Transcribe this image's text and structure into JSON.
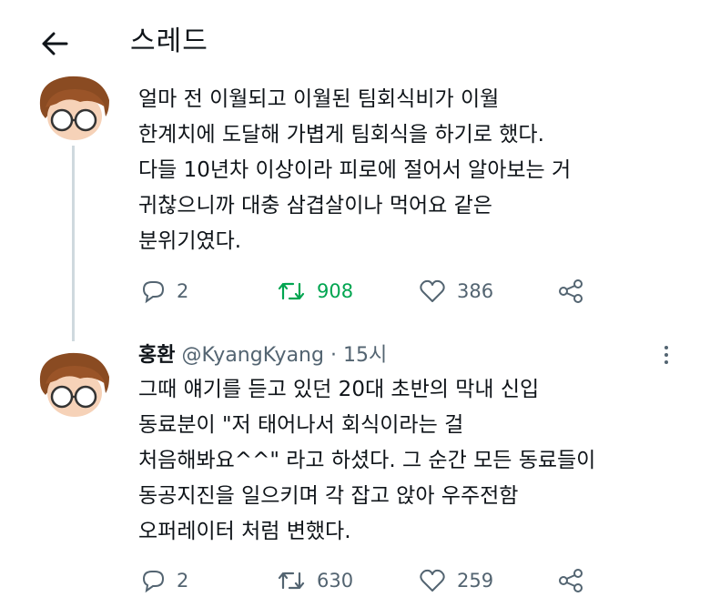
{
  "header": {
    "title": "스레드",
    "back_icon": "arrow-left-icon"
  },
  "tweets": [
    {
      "text": "얼마 전 이월되고 이월된 팀회식비가 이월\n한계치에 도달해 가볍게 팀회식을 하기로 했다.\n다들 10년차 이상이라 피로에 절어서 알아보는 거\n귀찮으니까 대충 삼겹살이나 먹어요 같은\n분위기였다.",
      "reply_count": "2",
      "retweet_count": "908",
      "like_count": "386",
      "retweet_active": true
    },
    {
      "name": "홍환",
      "handle": "@KyangKyang",
      "separator": "·",
      "time": "15시",
      "text": "그때 얘기를 듣고 있던 20대 초반의 막내 신입\n동료분이 \"저 태어나서 회식이라는 걸\n처음해봐요^^\" 라고 하셨다. 그 순간 모든 동료들이\n동공지진을 일으키며 각 잡고 앉아 우주전함\n오퍼레이터 처럼 변했다.",
      "reply_count": "2",
      "retweet_count": "630",
      "like_count": "259",
      "retweet_active": false
    }
  ],
  "colors": {
    "text": "#0f1419",
    "muted": "#536471",
    "retweet_active": "#00a550",
    "thread_line": "#cfd9de"
  },
  "icons": {
    "reply": "reply-icon",
    "retweet": "retweet-icon",
    "like": "heart-icon",
    "share": "share-icon",
    "more": "more-dots-icon",
    "avatar": "cartoon-avatar"
  }
}
